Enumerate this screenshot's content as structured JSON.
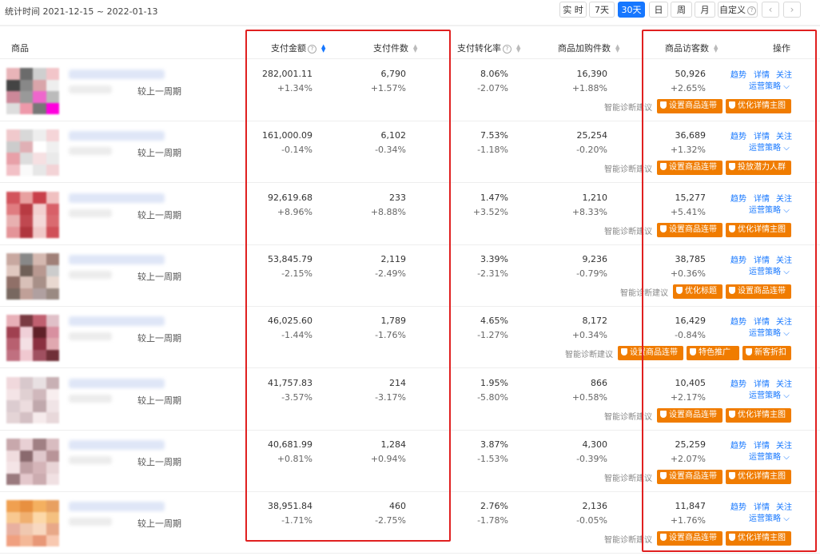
{
  "filter": {
    "stat_label": "统计时间 2021-12-15 ~ 2022-01-13",
    "ranges": [
      "实 时",
      "7天",
      "30天",
      "日",
      "周",
      "月",
      "自定义"
    ],
    "active_range": "30天",
    "prev_icon": "chevron-left-icon",
    "next_icon": "chevron-right-icon"
  },
  "table": {
    "headers": {
      "product": "商品",
      "pay_amount": "支付金额",
      "pay_count": "支付件数",
      "conversion": "支付转化率",
      "add_cart": "商品加购件数",
      "visitors": "商品访客数",
      "ops": "操作"
    },
    "compare_label": "较上一周期",
    "actions": {
      "trend": "趋势",
      "detail": "详情",
      "follow": "关注",
      "strategy": "运营策略"
    },
    "diag_label": "智能诊断建议",
    "rows": [
      {
        "pay_amount": "282,001.11",
        "pay_amount_chg": "+1.34%",
        "pay_count": "6,790",
        "pay_count_chg": "+1.57%",
        "conversion": "8.06%",
        "conversion_chg": "-2.07%",
        "add_cart": "16,390",
        "add_cart_chg": "+1.88%",
        "visitors": "50,926",
        "visitors_chg": "+2.65%",
        "buttons": [
          "设置商品连带",
          "优化详情主图"
        ]
      },
      {
        "pay_amount": "161,000.09",
        "pay_amount_chg": "-0.14%",
        "pay_count": "6,102",
        "pay_count_chg": "-0.34%",
        "conversion": "7.53%",
        "conversion_chg": "-1.18%",
        "add_cart": "25,254",
        "add_cart_chg": "-0.20%",
        "visitors": "36,689",
        "visitors_chg": "+1.32%",
        "buttons": [
          "设置商品连带",
          "投放潜力人群"
        ]
      },
      {
        "pay_amount": "92,619.68",
        "pay_amount_chg": "+8.96%",
        "pay_count": "233",
        "pay_count_chg": "+8.88%",
        "conversion": "1.47%",
        "conversion_chg": "+3.52%",
        "add_cart": "1,210",
        "add_cart_chg": "+8.33%",
        "visitors": "15,277",
        "visitors_chg": "+5.41%",
        "buttons": [
          "设置商品连带",
          "优化详情主图"
        ]
      },
      {
        "pay_amount": "53,845.79",
        "pay_amount_chg": "-2.15%",
        "pay_count": "2,119",
        "pay_count_chg": "-2.49%",
        "conversion": "3.39%",
        "conversion_chg": "-2.31%",
        "add_cart": "9,236",
        "add_cart_chg": "-0.79%",
        "visitors": "38,785",
        "visitors_chg": "+0.36%",
        "buttons": [
          "优化标题",
          "设置商品连带"
        ]
      },
      {
        "pay_amount": "46,025.60",
        "pay_amount_chg": "-1.44%",
        "pay_count": "1,789",
        "pay_count_chg": "-1.76%",
        "conversion": "4.65%",
        "conversion_chg": "-1.27%",
        "add_cart": "8,172",
        "add_cart_chg": "+0.34%",
        "visitors": "16,429",
        "visitors_chg": "-0.84%",
        "buttons": [
          "设置商品连带",
          "特色推广",
          "新客折扣"
        ]
      },
      {
        "pay_amount": "41,757.83",
        "pay_amount_chg": "-3.57%",
        "pay_count": "214",
        "pay_count_chg": "-3.17%",
        "conversion": "1.95%",
        "conversion_chg": "-5.80%",
        "add_cart": "866",
        "add_cart_chg": "+0.58%",
        "visitors": "10,405",
        "visitors_chg": "+2.17%",
        "buttons": [
          "设置商品连带",
          "优化详情主图"
        ]
      },
      {
        "pay_amount": "40,681.99",
        "pay_amount_chg": "+0.81%",
        "pay_count": "1,284",
        "pay_count_chg": "+0.94%",
        "conversion": "3.87%",
        "conversion_chg": "-1.53%",
        "add_cart": "4,300",
        "add_cart_chg": "-0.39%",
        "visitors": "25,259",
        "visitors_chg": "+2.07%",
        "buttons": [
          "设置商品连带",
          "优化详情主图"
        ]
      },
      {
        "pay_amount": "38,951.84",
        "pay_amount_chg": "-1.71%",
        "pay_count": "460",
        "pay_count_chg": "-2.75%",
        "conversion": "2.76%",
        "conversion_chg": "-1.78%",
        "add_cart": "2,136",
        "add_cart_chg": "-0.05%",
        "visitors": "11,847",
        "visitors_chg": "+1.76%",
        "buttons": [
          "设置商品连带",
          "优化详情主图"
        ]
      }
    ]
  },
  "colors": {
    "accent": "#1677ff",
    "button": "#f07c00",
    "highlight_box": "#e02020"
  }
}
